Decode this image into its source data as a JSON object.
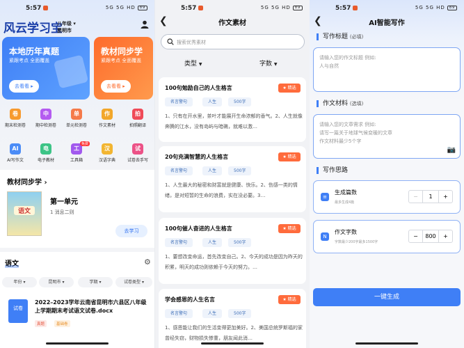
{
  "status": {
    "time": "5:57",
    "signal": "5G 5G HD",
    "battery": "89"
  },
  "home": {
    "logo": "风云学习宝",
    "grade": "八年级",
    "city": "昆明市",
    "card_left": {
      "title": "本地历年真题",
      "sub": "紧跟考点 全面覆盖",
      "btn": "去看看 ▸"
    },
    "card_right": {
      "title": "教材同步学",
      "sub": "紧跟考点 全面覆盖",
      "btn": "去看看 ▸"
    },
    "tools": [
      {
        "label": "期末检测卷",
        "icon": "卷",
        "color": "#f79a2e"
      },
      {
        "label": "期中检测卷",
        "icon": "中",
        "color": "#b45bf0"
      },
      {
        "label": "单元检测卷",
        "icon": "单",
        "color": "#f57a4a"
      },
      {
        "label": "作文素材",
        "icon": "作",
        "color": "#f2a72a"
      },
      {
        "label": "拍照翻译",
        "icon": "拍",
        "color": "#ef4a58"
      },
      {
        "label": "AI写作文",
        "icon": "AI",
        "color": "#4b8cf7"
      },
      {
        "label": "电子教材",
        "icon": "电",
        "color": "#3cc486"
      },
      {
        "label": "工具箱",
        "icon": "工",
        "color": "#a159ee",
        "badge": "免费"
      },
      {
        "label": "汉语字典",
        "icon": "汉",
        "color": "#f2b531"
      },
      {
        "label": "试卷去手写",
        "icon": "试",
        "color": "#ec5287"
      }
    ],
    "sync_title": "教材同步学 ›",
    "book_cover": "语文",
    "unit": "第一单元",
    "unit_sub": "1 消息二则",
    "study_btn": "去学习",
    "subject": "语文",
    "filters": [
      "年份 ▾",
      "昆明市 ▾",
      "学期 ▾",
      "试卷类型 ▾"
    ],
    "doc": {
      "icon": "试卷",
      "title": "2022–2023学年云南省昆明市六县区八年级上学期期末考试语文试卷.docx",
      "tags": [
        "真题",
        "基础卷"
      ]
    }
  },
  "essay": {
    "nav_title": "作文素材",
    "search_placeholder": "搜索优秀素材",
    "tab_type": "类型",
    "tab_words": "字数",
    "pick_label": "精选",
    "items": [
      {
        "title": "100句勉励自己的人生格言",
        "tags": [
          "名言警句",
          "人生",
          "500字"
        ],
        "excerpt": "1、只有在开水里，茶叶才能展开生命浓郁的香气。2、人生就像奔腾的江水，没有岛屿与暗礁，就难以激…"
      },
      {
        "title": "20句充满智慧的人生格言",
        "tags": [
          "名言警句",
          "人生",
          "500字"
        ],
        "excerpt": "1、人生最大的秘密和财富就是健康、快乐。2、伤感一类的情绪，是对短暂的生命的浪费，实在没必要。3…"
      },
      {
        "title": "100句催人奋进的人生格言",
        "tags": [
          "名言警句",
          "人生",
          "500字"
        ],
        "excerpt": "1、要想改变命运，首先改变自己。2、今天的成功是因为昨天的积累，明天的成功则依赖于今天的努力。…"
      },
      {
        "title": "学会感恩的人生名言",
        "tags": [
          "名言警句",
          "人生",
          "500字"
        ],
        "excerpt": "1、感恩能让我们的生活变得更加美好。2、美国总统罗斯福的家曾经失窃，财物损失惨重，朋友闻此消…"
      }
    ]
  },
  "ai": {
    "nav_title": "AI智能写作",
    "title_label": "写作标题",
    "title_req": "(必填)",
    "title_placeholder_1": "请输入您的作文标题 例如:",
    "title_placeholder_2": "人与自然",
    "material_label": "作文材料",
    "material_opt": "(选填)",
    "material_ph_1": "请输入您的文章需求 例如:",
    "material_ph_2": "请写一篇关于地球气候变暖的文章",
    "material_ph_3": "作文材料最少5个字",
    "idea_label": "写作思路",
    "count": {
      "title": "生成篇数",
      "sub": "最多生成4篇",
      "minus": "−",
      "value": "1",
      "plus": "+"
    },
    "words": {
      "title": "作文字数",
      "sub": "字数最少200字最多1500字",
      "minus": "−",
      "value": "800",
      "plus": "+"
    },
    "generate_btn": "一键生成"
  }
}
